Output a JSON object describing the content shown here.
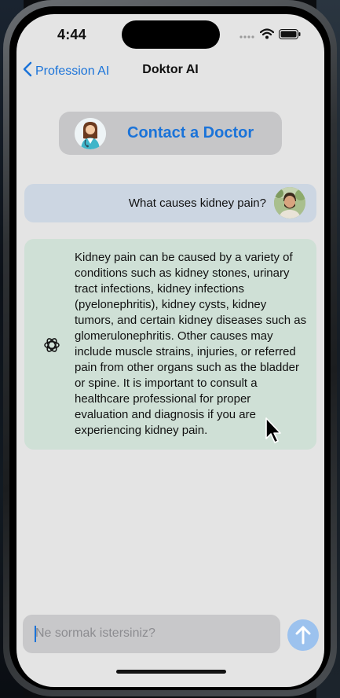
{
  "status_bar": {
    "time": "4:44"
  },
  "nav": {
    "back_label": "Profession AI",
    "title": "Doktor AI"
  },
  "contact": {
    "label": "Contact a Doctor"
  },
  "chat": {
    "user_message": "What causes kidney pain?",
    "ai_message": "Kidney pain can be caused by a variety of conditions such as kidney stones, urinary tract infections, kidney infections (pyelonephritis), kidney cysts, kidney tumors, and certain kidney diseases such as glomerulonephritis. Other causes may include muscle strains, injuries, or referred pain from other organs such as the bladder or spine. It is important to consult a healthcare professional for proper evaluation and diagnosis if you are experiencing kidney pain."
  },
  "input": {
    "placeholder": "Ne sormak istersiniz?",
    "value": ""
  },
  "colors": {
    "accent": "#1a73d9",
    "screen_bg": "#e4e4e4",
    "user_bubble": "#ccd6e2",
    "ai_bubble": "#cfe0d6",
    "send_button": "#9cc2ee"
  },
  "icons": {
    "back": "chevron-left-icon",
    "ai": "openai-logo-icon",
    "send": "arrow-up-icon",
    "signal": "cellular-signal-icon",
    "wifi": "wifi-icon",
    "battery": "battery-icon"
  }
}
